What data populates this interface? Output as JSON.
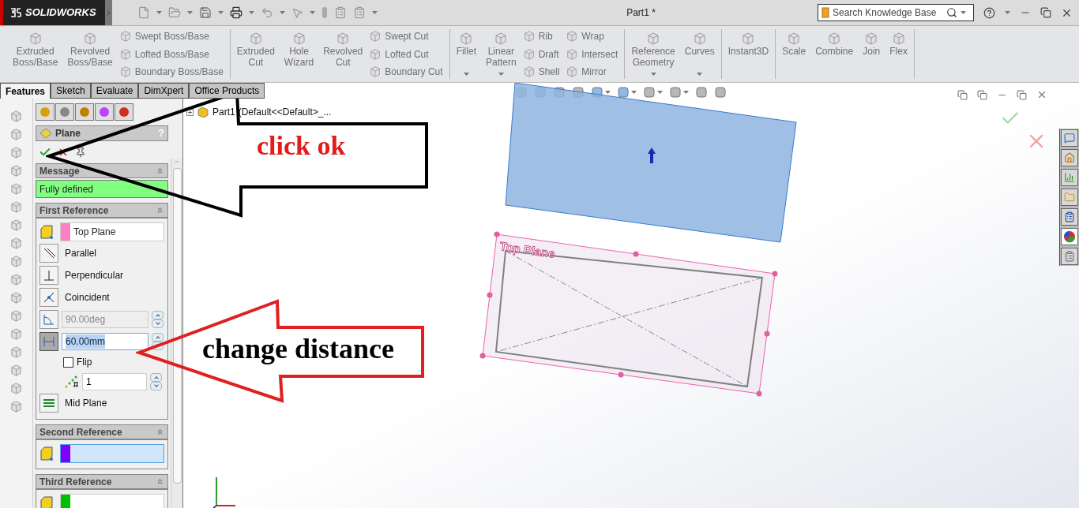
{
  "titlebar": {
    "logo": "SOLIDWORKS",
    "title": "Part1 *",
    "search": {
      "placeholder": "Search Knowledge Base"
    }
  },
  "ribbon": {
    "groups": [
      {
        "columns": [
          {
            "kind": "large",
            "label": "Extruded\nBoss/Base",
            "dropdown": false
          },
          {
            "kind": "large",
            "label": "Revolved\nBoss/Base",
            "dropdown": false
          },
          {
            "kind": "stack",
            "items": [
              "Swept Boss/Base",
              "Lofted Boss/Base",
              "Boundary Boss/Base"
            ]
          }
        ]
      },
      {
        "columns": [
          {
            "kind": "large",
            "label": "Extruded\nCut",
            "dropdown": false
          },
          {
            "kind": "large",
            "label": "Hole\nWizard",
            "dropdown": false
          },
          {
            "kind": "large",
            "label": "Revolved\nCut",
            "dropdown": false
          },
          {
            "kind": "stack",
            "items": [
              "Swept Cut",
              "Lofted Cut",
              "Boundary Cut"
            ]
          }
        ]
      },
      {
        "columns": [
          {
            "kind": "large",
            "label": "Fillet",
            "dropdown": true
          },
          {
            "kind": "large",
            "label": "Linear\nPattern",
            "dropdown": true
          },
          {
            "kind": "stack",
            "items": [
              "Rib",
              "Draft",
              "Shell"
            ]
          },
          {
            "kind": "stack",
            "items": [
              "Wrap",
              "Intersect",
              "Mirror"
            ]
          }
        ]
      },
      {
        "columns": [
          {
            "kind": "large",
            "label": "Reference\nGeometry",
            "dropdown": true
          },
          {
            "kind": "large",
            "label": "Curves",
            "dropdown": true
          }
        ]
      },
      {
        "columns": [
          {
            "kind": "large",
            "label": "Instant3D",
            "dropdown": false
          }
        ]
      },
      {
        "columns": [
          {
            "kind": "large",
            "label": "Scale",
            "dropdown": false
          },
          {
            "kind": "large",
            "label": "Combine",
            "dropdown": false
          },
          {
            "kind": "large",
            "label": "Join",
            "dropdown": false
          },
          {
            "kind": "large",
            "label": "Flex",
            "dropdown": false
          }
        ]
      }
    ]
  },
  "tabs": [
    {
      "label": "Features",
      "selected": true
    },
    {
      "label": "Sketch",
      "selected": false
    },
    {
      "label": "Evaluate",
      "selected": false
    },
    {
      "label": "DimXpert",
      "selected": false
    },
    {
      "label": "Office Products",
      "selected": false
    }
  ],
  "feature_tree": {
    "root": "Part1",
    "config": "(Default<<Default>_..."
  },
  "property_manager": {
    "title": "Plane",
    "help": "?",
    "sections": [
      {
        "kind": "message",
        "title": "Message",
        "text": "Fully defined"
      },
      {
        "kind": "reference",
        "title": "First Reference",
        "selection": {
          "value": "Top Plane",
          "color": "#ff80c0",
          "selected": false
        },
        "options": [
          {
            "kind": "parallel",
            "label": "Parallel",
            "pressed": false
          },
          {
            "kind": "perpendicular",
            "label": "Perpendicular",
            "pressed": false
          },
          {
            "kind": "coincident",
            "label": "Coincident",
            "pressed": false
          },
          {
            "kind": "angle",
            "value": "90.00deg",
            "disabled": true
          },
          {
            "kind": "distance",
            "value": "60.00mm",
            "pressed": true
          },
          {
            "kind": "checkbox",
            "label": "Flip",
            "checked": false
          },
          {
            "kind": "count",
            "value": "1"
          },
          {
            "kind": "midplane",
            "label": "Mid Plane",
            "pressed": false
          }
        ]
      },
      {
        "kind": "reference",
        "title": "Second Reference",
        "selection": {
          "color": "#8000ff",
          "selected": true
        }
      },
      {
        "kind": "reference",
        "title": "Third Reference",
        "selection": {
          "color": "#00c000",
          "selected": false
        }
      }
    ]
  },
  "graphics": {
    "plane_label": "Top Plane"
  },
  "task_pane": [
    {
      "selected": false
    },
    {
      "selected": false
    },
    {
      "selected": false
    },
    {
      "selected": false
    },
    {
      "selected": false
    },
    {
      "selected": true
    },
    {
      "selected": false
    }
  ],
  "annotations": [
    {
      "kind": "black",
      "text": "click ok"
    },
    {
      "kind": "red",
      "text": "change distance"
    }
  ]
}
